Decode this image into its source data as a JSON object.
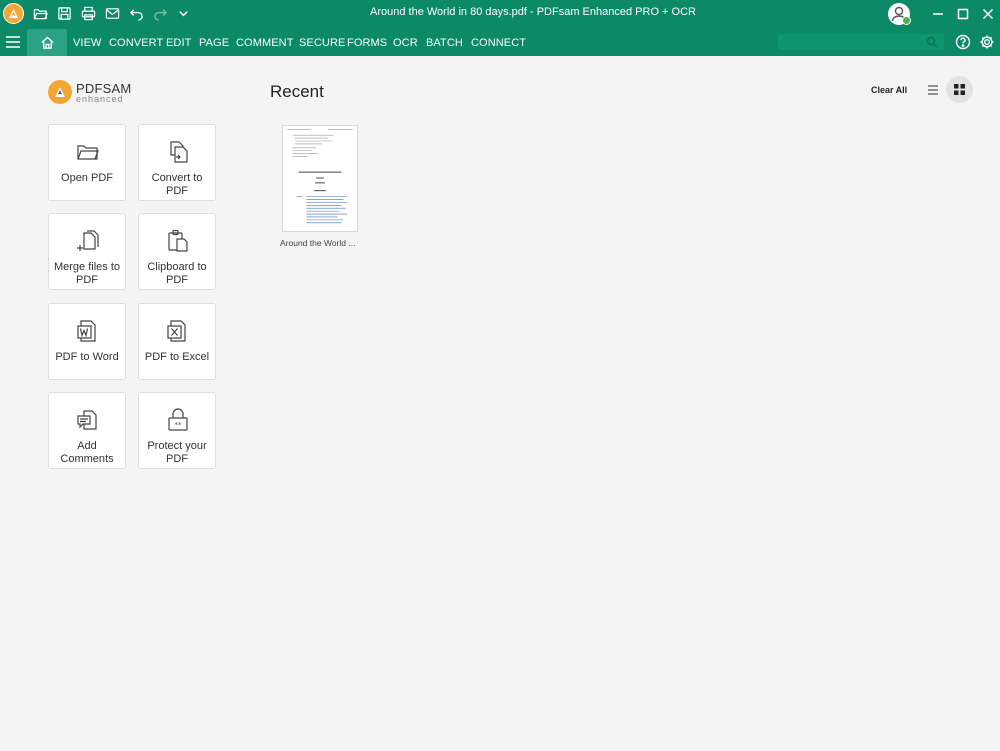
{
  "window": {
    "title": "Around the World in 80 days.pdf   -   PDFsam Enhanced PRO + OCR"
  },
  "quick_access": [
    "app-logo-icon",
    "open-folder-icon",
    "save-icon",
    "print-icon",
    "mail-icon",
    "undo-icon",
    "redo-icon",
    "chevron-down-icon"
  ],
  "menu": {
    "items": [
      "VIEW",
      "CONVERT",
      "EDIT",
      "PAGE",
      "COMMENT",
      "SECURE",
      "FORMS",
      "OCR",
      "BATCH",
      "CONNECT"
    ]
  },
  "search": {
    "placeholder": ""
  },
  "brand": {
    "name": "PDFSAM",
    "sub": "enhanced"
  },
  "tiles": [
    {
      "label": "Open PDF",
      "icon": "folder-icon"
    },
    {
      "label": "Convert to PDF",
      "icon": "convert-icon"
    },
    {
      "label": "Merge files to PDF",
      "icon": "merge-icon"
    },
    {
      "label": "Clipboard to PDF",
      "icon": "clipboard-icon"
    },
    {
      "label": "PDF to Word",
      "icon": "word-icon"
    },
    {
      "label": "PDF to Excel",
      "icon": "excel-icon"
    },
    {
      "label": "Add Comments",
      "icon": "comment-icon"
    },
    {
      "label": "Protect your PDF",
      "icon": "lock-icon"
    }
  ],
  "recent": {
    "title": "Recent",
    "clear_all": "Clear All",
    "files": [
      {
        "label": "Around the World ..."
      }
    ]
  },
  "colors": {
    "accent": "#0c8a68",
    "accent_light": "#2aa283",
    "brand_orange": "#f4a634",
    "background": "#f4f4f4"
  }
}
